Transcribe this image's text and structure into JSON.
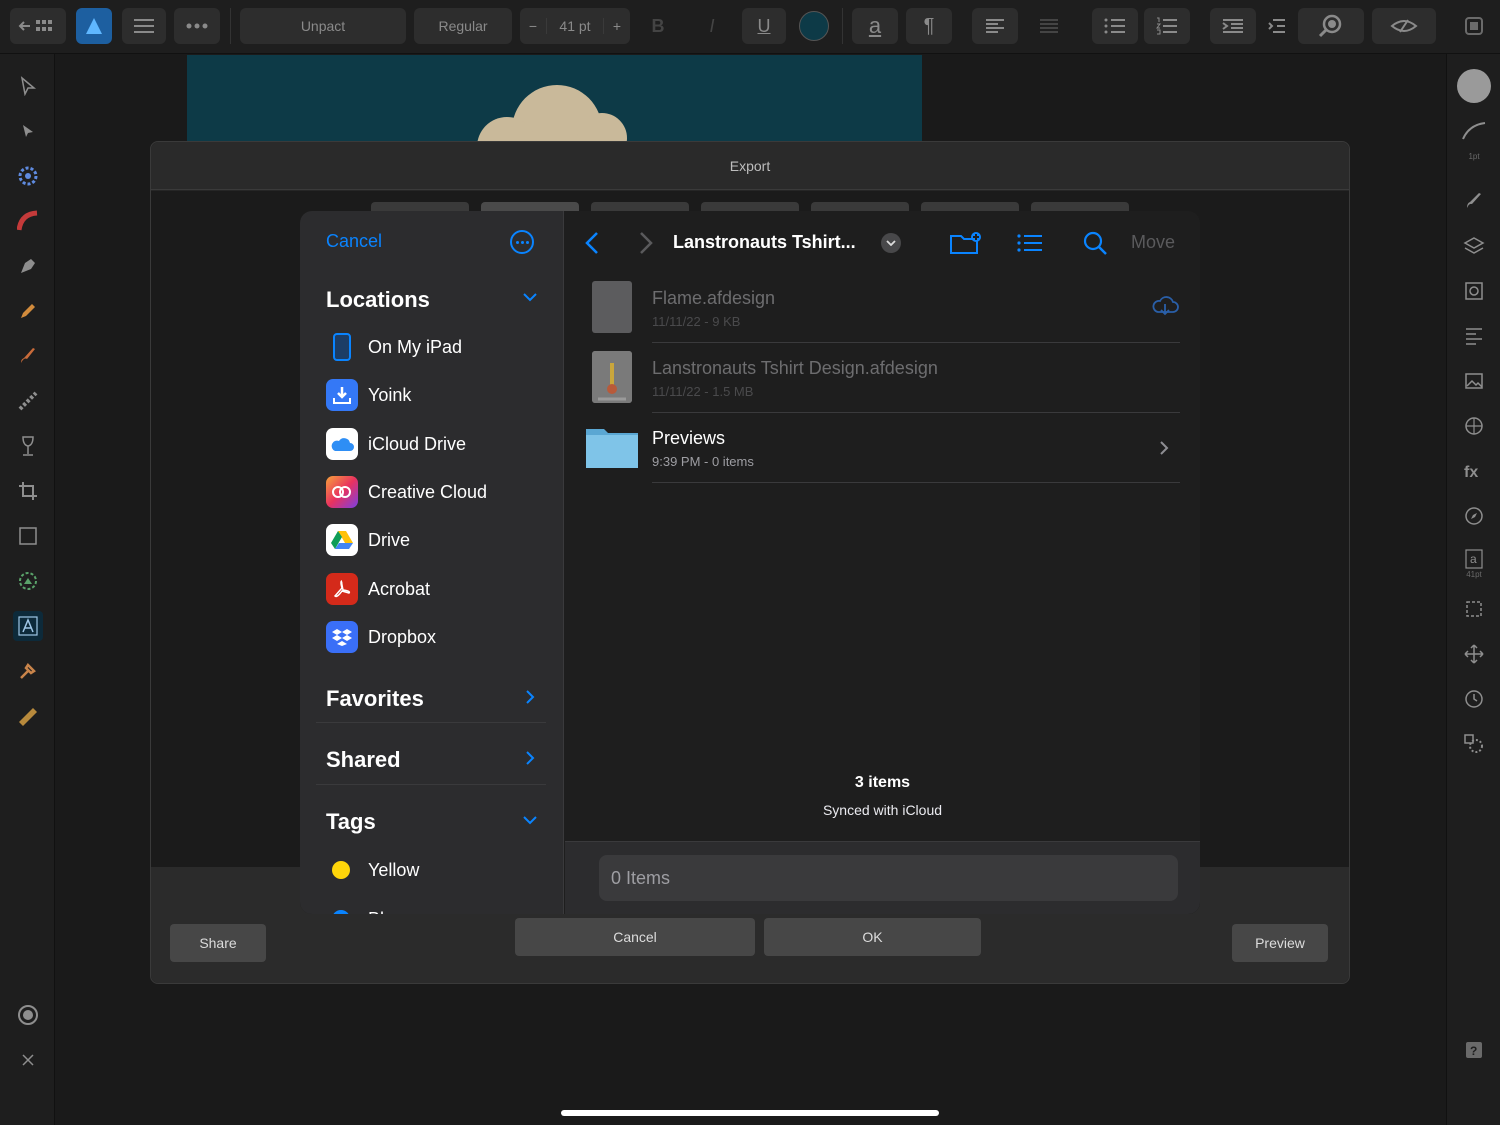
{
  "toolbar": {
    "font_name": "Unpact",
    "font_style": "Regular",
    "font_size": "41 pt",
    "minus": "−",
    "plus": "+",
    "bold": "B",
    "italic": "I",
    "underline": "U",
    "text_case": "a",
    "paragraph": "¶"
  },
  "right_tools": {
    "stroke_width": "1pt",
    "char_size": "41pt"
  },
  "export": {
    "title": "Export",
    "share_label": "Share",
    "cancel_label": "Cancel",
    "ok_label": "OK",
    "preview_label": "Preview"
  },
  "picker": {
    "cancel_label": "Cancel",
    "move_label": "Move",
    "folder_title": "Lanstronauts Tshirt...",
    "sections": {
      "locations": "Locations",
      "favorites": "Favorites",
      "shared": "Shared",
      "tags": "Tags"
    },
    "locations": [
      {
        "label": "On My iPad",
        "icon": "ipad-icon",
        "color": "#0a84ff"
      },
      {
        "label": "Yoink",
        "icon": "yoink-icon",
        "color": "#3478f6"
      },
      {
        "label": "iCloud Drive",
        "icon": "icloud-icon",
        "color": "#ffffff"
      },
      {
        "label": "Creative Cloud",
        "icon": "creative-cloud-icon",
        "color": "#e8325f"
      },
      {
        "label": "Drive",
        "icon": "google-drive-icon",
        "color": "#ffffff"
      },
      {
        "label": "Acrobat",
        "icon": "acrobat-icon",
        "color": "#d42a1a"
      },
      {
        "label": "Dropbox",
        "icon": "dropbox-icon",
        "color": "#3a6ff7"
      }
    ],
    "tags": [
      {
        "label": "Yellow",
        "color": "#ffd60a"
      },
      {
        "label": "Bl",
        "color": "#0a84ff"
      }
    ],
    "files": [
      {
        "name": "Flame.afdesign",
        "meta": "11/11/22 - 9 KB",
        "type": "file",
        "cloud": true
      },
      {
        "name": "Lanstronauts Tshirt Design.afdesign",
        "meta": "11/11/22 - 1.5 MB",
        "type": "file",
        "cloud": false
      },
      {
        "name": "Previews",
        "meta": "9:39 PM - 0 items",
        "type": "folder",
        "cloud": false
      }
    ],
    "item_count": "3 items",
    "sync_status": "Synced with iCloud",
    "selection_field": "0 Items"
  },
  "colors": {
    "accent": "#0a84ff",
    "folder": "#7fc4e8"
  }
}
